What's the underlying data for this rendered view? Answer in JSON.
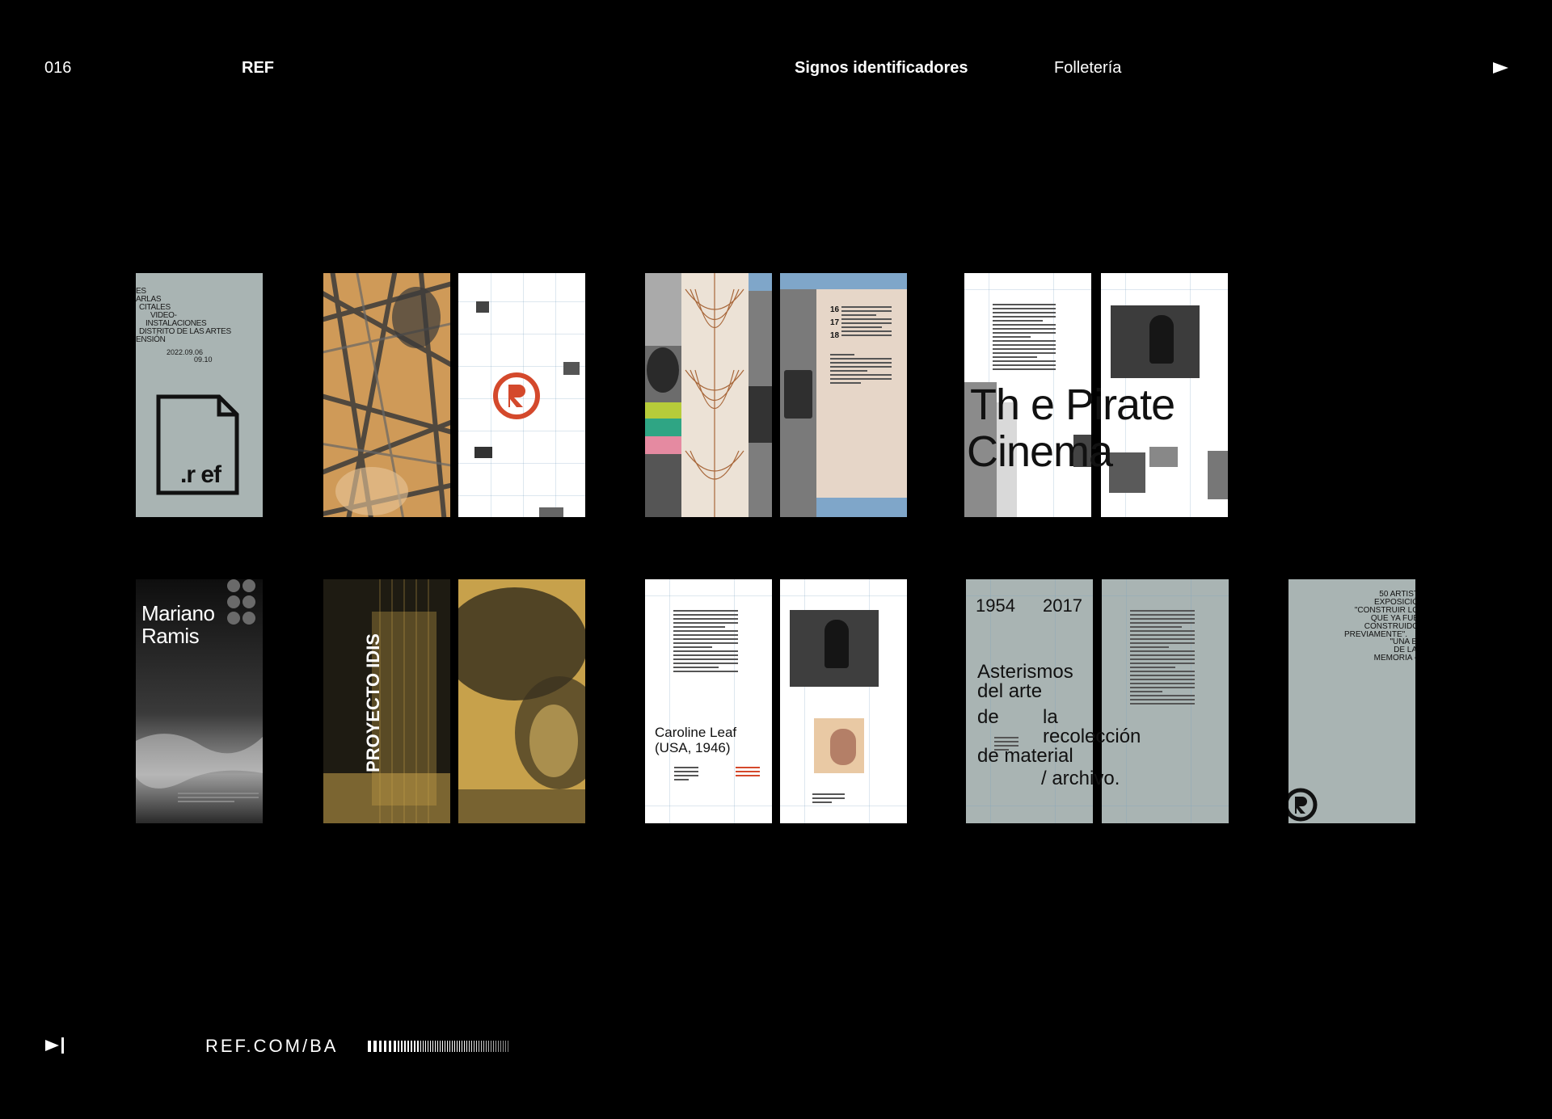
{
  "header": {
    "page_number": "016",
    "brand": "REF",
    "section": "Signos identificadores",
    "subsection": "Folletería"
  },
  "footer": {
    "url": "REF.COM/BA"
  },
  "icons": {
    "next": "play-triangle-icon",
    "end": "skip-to-end-icon",
    "barcode": "barcode-icon",
    "ref_logo": "ref-r-logo-icon"
  },
  "colors": {
    "background": "#000000",
    "sage": "#a9b4b3",
    "mustard": "#c9a24a",
    "ochre": "#d7a257",
    "red": "#d4492c",
    "steel_blue": "#7fa6c9",
    "paper": "#ffffff"
  },
  "brochures": {
    "r1_sage": {
      "lines": [
        "ES",
        "ARLAS",
        "CITALES",
        "VIDEO-",
        "INSTALACIONES",
        "DISTRITO DE LAS ARTES",
        "ENSIÓN"
      ],
      "date_a": "2022.09.06",
      "date_b": "09.10",
      "logo": ".r ef"
    },
    "r1_pirate": {
      "title_a": "Th e Pirate",
      "title_b": "Cinema"
    },
    "r1_film": {
      "nums": [
        "16",
        "17",
        "18"
      ]
    },
    "r2_mariano": {
      "title_a": "Mariano",
      "title_b": "Ramis"
    },
    "r2_idis": {
      "title": "PROYECTO IDIS"
    },
    "r2_caroline": {
      "title_a": "Caroline Leaf",
      "title_b": "(USA, 1946)"
    },
    "r2_asterismos": {
      "year_a": "1954",
      "year_b": "2017",
      "line1": "Asterismos",
      "line2": "del arte",
      "line3a": "de",
      "line3b": "la",
      "line4": "recolección",
      "line5": "de material",
      "line6": "/ archivo."
    },
    "r2_exhibit": {
      "line1": "50 ARTIST",
      "line2": "EXPOSICIÓ",
      "line3": "\"CONSTRUIR LO",
      "line4": "QUE YA FUE",
      "line5": "CONSTRUIDO",
      "line6": "PREVIAMENTE\".",
      "line7": "\"UNA E",
      "line8": "DE LA",
      "line9": "MEMORIA -"
    }
  }
}
